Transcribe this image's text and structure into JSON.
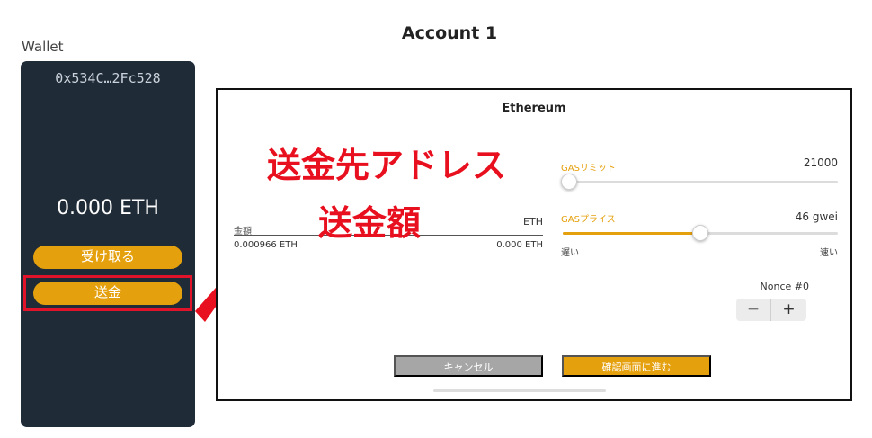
{
  "header": {
    "account_title": "Account 1"
  },
  "wallet": {
    "label": "Wallet",
    "address": "0x534C…2Fc528",
    "balance": "0.000 ETH",
    "receive_label": "受け取る",
    "send_label": "送金"
  },
  "dialog": {
    "title": "Ethereum",
    "destination_annotation": "送金先アドレス",
    "amount_annotation": "送金額",
    "amount": {
      "label": "金額",
      "unit": "ETH",
      "value": "0.000966 ETH",
      "fiat_value": "0.000 ETH"
    },
    "gas_limit": {
      "label": "GASリミット",
      "value": "21000",
      "level": 0.0
    },
    "gas_price": {
      "label": "GASプライス",
      "value": "46 gwei",
      "level": 0.5,
      "slow_label": "遅い",
      "fast_label": "速い"
    },
    "nonce": {
      "label": "Nonce #0",
      "minus": "−",
      "plus": "+"
    },
    "cancel_label": "キャンセル",
    "confirm_label": "確認画面に進む"
  },
  "colors": {
    "accent": "#e5a00d",
    "panel_bg": "#1f2b37",
    "annotation_red": "#e8101f"
  },
  "icons": {
    "arrow": "red-arrow-icon"
  }
}
